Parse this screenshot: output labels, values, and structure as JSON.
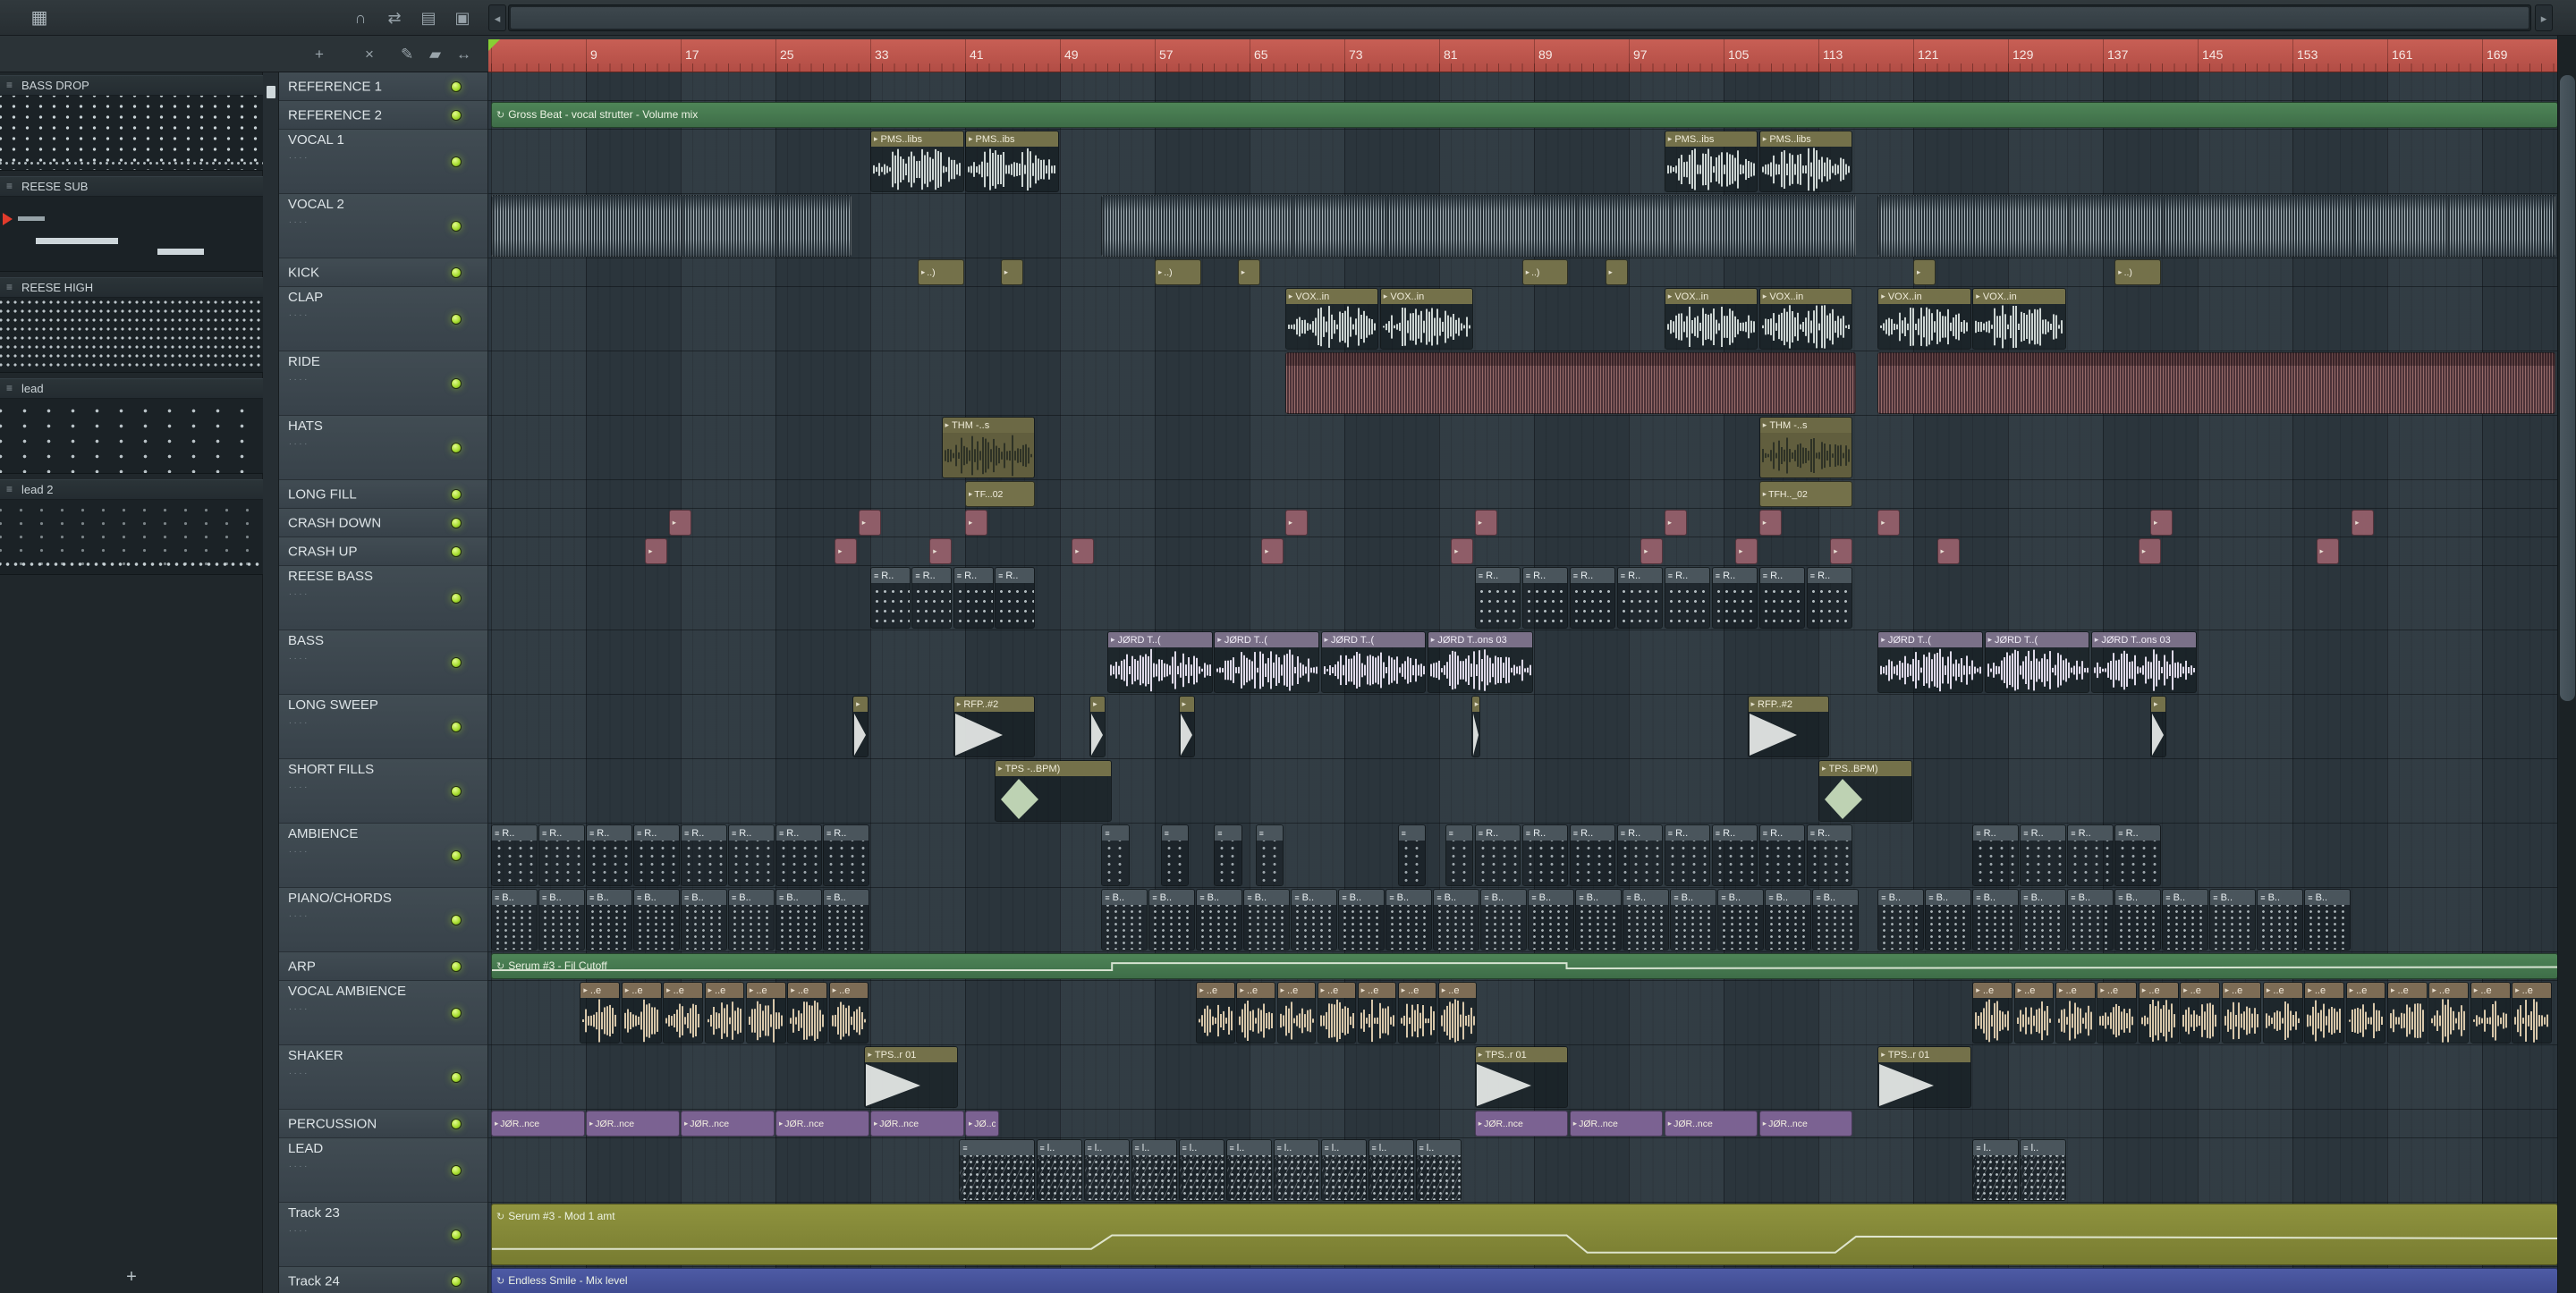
{
  "window": {
    "app": "FL Studio",
    "view": "Playlist"
  },
  "colors": {
    "ruler": "#c0574e",
    "grid": "#2d3840",
    "panel": "#39434a",
    "picker": "#20272b",
    "led": "#a8dd30",
    "auto_green": "#467a50",
    "auto_olive": "#888c3a",
    "auto_blue": "#4a57a0",
    "clip_olive": "#74714a",
    "clip_maroon": "#8f5d68",
    "clip_purple": "#7b6292",
    "clip_tan": "#7d6c55",
    "clip_slate": "#4a555c",
    "ride": "#4c3238"
  },
  "icons": {
    "audio_clip": "▸",
    "pattern_clip": "≡",
    "automation_clip": "↻",
    "menu_grid": "▦",
    "scroll_left": "◂",
    "scroll_right": "▸",
    "picker_add": "+"
  },
  "toolbar": {
    "window_tools": [
      {
        "name": "magnet-icon",
        "glyph": "∩"
      },
      {
        "name": "swap-icon",
        "glyph": "⇄"
      },
      {
        "name": "layers-icon",
        "glyph": "▤"
      },
      {
        "name": "detach-icon",
        "glyph": "▣"
      }
    ],
    "playlist_tools": [
      {
        "name": "add-tool-icon",
        "glyph": "+"
      },
      {
        "name": "cut-tool-icon",
        "glyph": "×"
      },
      {
        "name": "pencil-tool-icon",
        "glyph": "✎"
      },
      {
        "name": "paint-tool-icon",
        "glyph": "▰"
      },
      {
        "name": "slip-tool-icon",
        "glyph": "↔"
      }
    ]
  },
  "timeline": {
    "numbers": [
      9,
      17,
      25,
      33,
      41,
      49,
      57,
      65,
      73,
      81,
      89,
      97,
      105,
      113,
      121,
      129,
      137,
      145,
      153,
      161,
      169
    ]
  },
  "picker": {
    "items": [
      {
        "label": "BASS DROP",
        "preview": "steps",
        "playing": false
      },
      {
        "label": "REESE SUB",
        "preview": "bars",
        "playing": true
      },
      {
        "label": "REESE HIGH",
        "preview": "dense",
        "playing": false
      },
      {
        "label": "lead",
        "preview": "sparse",
        "playing": false
      },
      {
        "label": "lead 2",
        "preview": "bottomrow",
        "playing": false
      }
    ],
    "add_label": "+"
  },
  "tracks": [
    {
      "name": "REFERENCE 1",
      "size": "small"
    },
    {
      "name": "REFERENCE 2",
      "size": "small"
    },
    {
      "name": "VOCAL 1",
      "size": "tall"
    },
    {
      "name": "VOCAL 2",
      "size": "tall"
    },
    {
      "name": "KICK",
      "size": "small"
    },
    {
      "name": "CLAP",
      "size": "tall"
    },
    {
      "name": "RIDE",
      "size": "tall"
    },
    {
      "name": "HATS",
      "size": "tall"
    },
    {
      "name": "LONG FILL",
      "size": "small"
    },
    {
      "name": "CRASH DOWN",
      "size": "small"
    },
    {
      "name": "CRASH UP",
      "size": "small"
    },
    {
      "name": "REESE BASS",
      "size": "tall"
    },
    {
      "name": "BASS",
      "size": "tall"
    },
    {
      "name": "LONG SWEEP",
      "size": "tall"
    },
    {
      "name": "SHORT FILLS",
      "size": "tall"
    },
    {
      "name": "AMBIENCE",
      "size": "tall"
    },
    {
      "name": "PIANO/CHORDS",
      "size": "tall"
    },
    {
      "name": "ARP",
      "size": "small"
    },
    {
      "name": "VOCAL AMBIENCE",
      "size": "tall"
    },
    {
      "name": "SHAKER",
      "size": "tall"
    },
    {
      "name": "PERCUSSION",
      "size": "small"
    },
    {
      "name": "LEAD",
      "size": "tall"
    },
    {
      "name": "Track 23",
      "size": "tall"
    },
    {
      "name": "Track 24",
      "size": "small"
    }
  ],
  "clips": [
    {
      "t": 1,
      "type": "auto",
      "style": "green",
      "b": 1,
      "l": 174.5,
      "label": "Gross Beat - vocal strutter - Volume mix"
    },
    {
      "t": 2,
      "type": "audio",
      "style": "vocal",
      "b": 33,
      "l": 8,
      "label": "PMS..libs"
    },
    {
      "t": 2,
      "type": "audio",
      "style": "vocal",
      "b": 41,
      "l": 8,
      "label": "PMS..ibs"
    },
    {
      "t": 2,
      "type": "audio",
      "style": "vocal",
      "b": 100,
      "l": 8,
      "label": "PMS..ibs"
    },
    {
      "t": 2,
      "type": "audio",
      "style": "vocal",
      "b": 108,
      "l": 8,
      "label": "PMS..libs"
    },
    {
      "t": 3,
      "type": "stripes",
      "b": 1,
      "l": 30.5
    },
    {
      "t": 3,
      "type": "stripes",
      "b": 52.5,
      "l": 63.8
    },
    {
      "t": 3,
      "type": "stripes",
      "b": 118,
      "l": 57.3
    },
    {
      "t": 4,
      "type": "small",
      "style": "olive",
      "b": 37,
      "l": 4,
      "label": "..)"
    },
    {
      "t": 4,
      "type": "small",
      "style": "olive",
      "b": 44,
      "l": 2,
      "label": ""
    },
    {
      "t": 4,
      "type": "small",
      "style": "olive",
      "b": 57,
      "l": 4,
      "label": "..)"
    },
    {
      "t": 4,
      "type": "small",
      "style": "olive",
      "b": 64,
      "l": 2,
      "label": ""
    },
    {
      "t": 4,
      "type": "small",
      "style": "olive",
      "b": 88,
      "l": 4,
      "label": "..)"
    },
    {
      "t": 4,
      "type": "small",
      "style": "olive",
      "b": 95,
      "l": 2,
      "label": ""
    },
    {
      "t": 4,
      "type": "small",
      "style": "olive",
      "b": 121,
      "l": 2,
      "label": ""
    },
    {
      "t": 4,
      "type": "small",
      "style": "olive",
      "b": 138,
      "l": 4,
      "label": "..)"
    },
    {
      "t": 5,
      "type": "audio",
      "style": "vocal",
      "b": 68,
      "l": 8,
      "n": 2,
      "label": "VOX..in"
    },
    {
      "t": 5,
      "type": "audio",
      "style": "vocal",
      "b": 100,
      "l": 8,
      "n": 2,
      "label": "VOX..in"
    },
    {
      "t": 5,
      "type": "audio",
      "style": "vocal",
      "b": 118,
      "l": 8,
      "n": 2,
      "label": "VOX..in"
    },
    {
      "t": 6,
      "type": "ride",
      "b": 68,
      "l": 48.3
    },
    {
      "t": 6,
      "type": "ride",
      "b": 118,
      "l": 57.3
    },
    {
      "t": 7,
      "type": "audio",
      "style": "dark",
      "b": 39,
      "l": 8,
      "label": "THM -..s"
    },
    {
      "t": 7,
      "type": "audio",
      "style": "dark",
      "b": 108,
      "l": 8,
      "label": "THM -..s"
    },
    {
      "t": 8,
      "type": "small",
      "style": "olive",
      "b": 41,
      "l": 6,
      "label": "TF...02"
    },
    {
      "t": 8,
      "type": "small",
      "style": "olive",
      "b": 108,
      "l": 8,
      "label": "TFH.._02"
    },
    {
      "t": 9,
      "type": "small",
      "style": "maroon",
      "at": [
        16,
        32,
        41,
        68,
        84,
        100,
        108,
        118,
        141,
        158
      ],
      "l": 2,
      "label": ""
    },
    {
      "t": 10,
      "type": "small",
      "style": "maroon",
      "at": [
        14,
        30,
        38,
        50,
        66,
        82,
        98,
        106,
        114,
        123,
        140,
        155
      ],
      "l": 2,
      "label": ""
    },
    {
      "t": 11,
      "type": "pat",
      "style": "reese",
      "b": 33,
      "l": 3.5,
      "n": 4,
      "label": "R.."
    },
    {
      "t": 11,
      "type": "pat",
      "style": "reese",
      "b": 84,
      "l": 4,
      "n": 8,
      "label": "R.."
    },
    {
      "t": 12,
      "type": "audio",
      "style": "bass",
      "b": 53,
      "l": 9,
      "n": 3,
      "label": "JØRD T..("
    },
    {
      "t": 12,
      "type": "audio",
      "style": "bass",
      "b": 80,
      "l": 9,
      "label": "JØRD T..ons 03"
    },
    {
      "t": 12,
      "type": "audio",
      "style": "bass",
      "b": 118,
      "l": 9,
      "n": 2,
      "label": "JØRD T..("
    },
    {
      "t": 12,
      "type": "audio",
      "style": "bass",
      "b": 136,
      "l": 9,
      "label": "JØRD T..ons 03"
    },
    {
      "t": 13,
      "type": "audio",
      "style": "thin",
      "at": [
        31.5,
        51.5,
        59,
        141
      ],
      "l": 1.5,
      "label": ""
    },
    {
      "t": 13,
      "type": "audio",
      "style": "thin",
      "b": 83.7,
      "l": 0.9,
      "label": ""
    },
    {
      "t": 13,
      "type": "audio",
      "style": "sweep",
      "b": 40,
      "l": 7,
      "label": "RFP..#2"
    },
    {
      "t": 13,
      "type": "audio",
      "style": "sweep",
      "b": 107,
      "l": 7,
      "label": "RFP..#2"
    },
    {
      "t": 14,
      "type": "audio",
      "style": "fill",
      "b": 43.5,
      "l": 10,
      "label": "TPS -..BPM)"
    },
    {
      "t": 14,
      "type": "audio",
      "style": "fill",
      "b": 113,
      "l": 8,
      "label": "TPS..BPM)"
    },
    {
      "t": 15,
      "type": "pat",
      "style": "amb",
      "b": 1,
      "l": 4,
      "n": 8,
      "label": "R.."
    },
    {
      "t": 15,
      "type": "pat",
      "style": "amb",
      "at": [
        52.5,
        57.5,
        62,
        65.5,
        77.5,
        81.5
      ],
      "l": 2.5,
      "label": ""
    },
    {
      "t": 15,
      "type": "pat",
      "style": "amb",
      "b": 84,
      "l": 4,
      "n": 8,
      "label": "R.."
    },
    {
      "t": 15,
      "type": "pat",
      "style": "amb",
      "b": 126,
      "l": 4,
      "n": 4,
      "label": "R.."
    },
    {
      "t": 16,
      "type": "pat",
      "style": "piano",
      "b": 1,
      "l": 4,
      "n": 8,
      "label": "B.."
    },
    {
      "t": 16,
      "type": "pat",
      "style": "piano",
      "b": 52.5,
      "l": 4,
      "n": 16,
      "label": "B.."
    },
    {
      "t": 16,
      "type": "pat",
      "style": "piano",
      "b": 118,
      "l": 4,
      "n": 10,
      "label": "B.."
    },
    {
      "t": 17,
      "type": "auto",
      "style": "green",
      "b": 1,
      "l": 174.5,
      "label": "Serum #3 - Fil Cutoff",
      "pts": [
        [
          0,
          0.62
        ],
        [
          0.3,
          0.62
        ],
        [
          0.3,
          0.35
        ],
        [
          0.52,
          0.35
        ],
        [
          0.52,
          0.55
        ],
        [
          1,
          0.5
        ]
      ]
    },
    {
      "t": 18,
      "type": "audio",
      "style": "tan",
      "b": 8.5,
      "l": 3.5,
      "n": 7,
      "label": "..e"
    },
    {
      "t": 18,
      "type": "audio",
      "style": "tan",
      "b": 60.5,
      "l": 3.4,
      "n": 7,
      "label": "..e"
    },
    {
      "t": 18,
      "type": "audio",
      "style": "tan",
      "b": 126,
      "l": 3.5,
      "n": 14,
      "label": "..e"
    },
    {
      "t": 19,
      "type": "audio",
      "style": "shaker",
      "at": [
        32.5,
        84,
        118
      ],
      "l": 8,
      "label": "TPS..r 01"
    },
    {
      "t": 20,
      "type": "small",
      "style": "purple",
      "b": 1,
      "l": 8,
      "n": 5,
      "label": "JØR..nce"
    },
    {
      "t": 20,
      "type": "small",
      "style": "purple",
      "b": 41,
      "l": 3,
      "label": "JØ..ce"
    },
    {
      "t": 20,
      "type": "small",
      "style": "purple",
      "b": 84,
      "l": 8,
      "n": 4,
      "label": "JØR..nce"
    },
    {
      "t": 21,
      "type": "pat",
      "style": "lead",
      "b": 40.5,
      "l": 6.5,
      "label": ""
    },
    {
      "t": 21,
      "type": "pat",
      "style": "lead",
      "b": 47,
      "l": 4,
      "n": 9,
      "label": "l.."
    },
    {
      "t": 21,
      "type": "pat",
      "style": "lead",
      "b": 126,
      "l": 4,
      "n": 2,
      "label": "l.."
    },
    {
      "t": 22,
      "type": "auto",
      "style": "olive",
      "b": 1,
      "l": 174.5,
      "label": "Serum #3 - Mod 1 amt",
      "pts": [
        [
          0,
          0.72
        ],
        [
          0.29,
          0.72
        ],
        [
          0.3,
          0.5
        ],
        [
          0.52,
          0.5
        ],
        [
          0.53,
          0.78
        ],
        [
          0.65,
          0.78
        ],
        [
          0.66,
          0.52
        ],
        [
          1,
          0.55
        ]
      ]
    },
    {
      "t": 23,
      "type": "auto",
      "style": "blue",
      "b": 1,
      "l": 174.5,
      "label": "Endless Smile - Mix level"
    }
  ]
}
